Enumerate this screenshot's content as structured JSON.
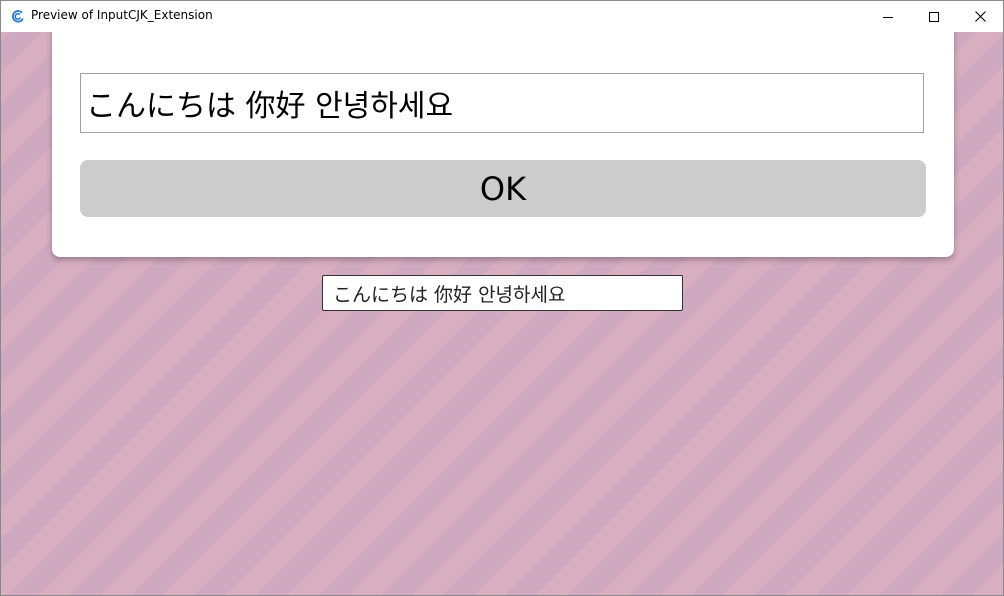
{
  "window": {
    "title": "Preview of InputCJK_Extension"
  },
  "titlebar_icons": {
    "app": "app-icon",
    "minimize": "minimize-icon",
    "maximize": "maximize-icon",
    "close": "close-icon"
  },
  "dialog": {
    "input_value": "こんにちは 你好 안녕하세요",
    "ok_label": "OK"
  },
  "main": {
    "input_value": "こんにちは 你好 안녕하세요"
  },
  "colors": {
    "background_stripe_light": "#d8aec1",
    "background_stripe_dark": "#cfa9bf",
    "ok_button": "#cccccc",
    "app_icon": "#2b7bd0"
  }
}
